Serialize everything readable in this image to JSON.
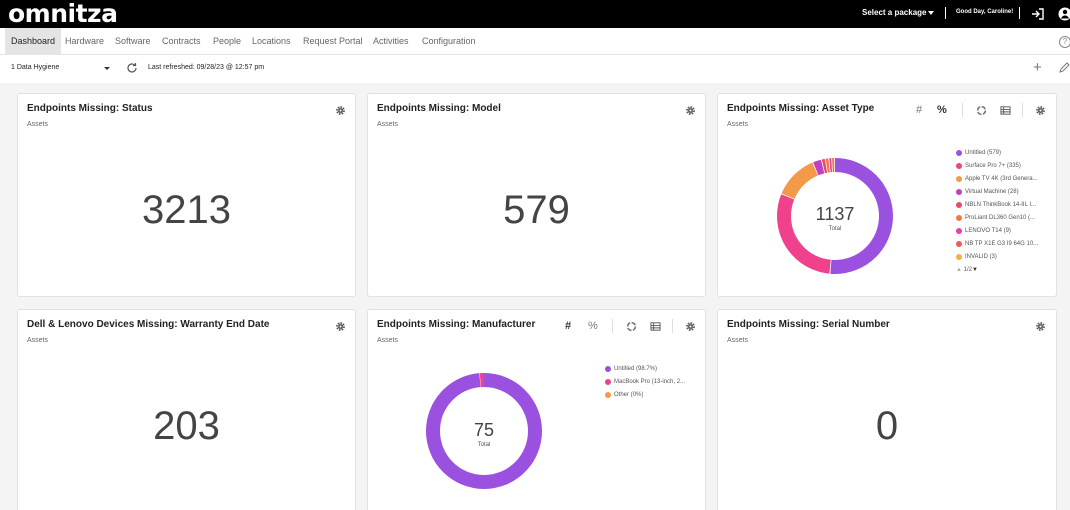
{
  "header": {
    "logo": "omnitza",
    "package_select": "Select a package",
    "greeting": "Good Day, Caroline!"
  },
  "nav": {
    "items": [
      "Dashboard",
      "Hardware",
      "Software",
      "Contracts",
      "People",
      "Locations",
      "Request Portal",
      "Activities",
      "Configuration"
    ],
    "active": "Dashboard"
  },
  "subbar": {
    "dashboard": "1 Data Hygiene",
    "last_refreshed": "Last refreshed: 09/28/23 @ 12:57 pm"
  },
  "cards": [
    {
      "title": "Endpoints Missing: Status",
      "subtitle": "Assets",
      "value": "3213"
    },
    {
      "title": "Endpoints Missing: Model",
      "subtitle": "Assets",
      "value": "579"
    },
    {
      "title": "Endpoints Missing: Asset Type",
      "subtitle": "Assets",
      "tools": [
        "#",
        "%"
      ],
      "donut": {
        "total": "1137",
        "total_label": "Total",
        "legend": [
          {
            "label": "Untitled (579)",
            "color": "#9b51e0"
          },
          {
            "label": "Surface Pro 7+ (335)",
            "color": "#f0418c"
          },
          {
            "label": "Apple TV 4K (3rd Genera...",
            "color": "#f2994a"
          },
          {
            "label": "Virtual Machine (28)",
            "color": "#c13fc4"
          },
          {
            "label": "NBLN ThinkBook 14-IIL I...",
            "color": "#e84a66"
          },
          {
            "label": "ProLiant DL360 Gen10 (...",
            "color": "#f07a3c"
          },
          {
            "label": "LENOVO T14 (9)",
            "color": "#e83fa8"
          },
          {
            "label": "NB TP X1E G3 I9 64G 10...",
            "color": "#f05a5a"
          },
          {
            "label": "INVALID (3)",
            "color": "#f2b04a"
          }
        ],
        "pager": "1/2"
      }
    },
    {
      "title": "Dell & Lenovo Devices Missing: Warranty End Date",
      "subtitle": "Assets",
      "value": "203"
    },
    {
      "title": "Endpoints Missing: Manufacturer",
      "subtitle": "Assets",
      "tools": [
        "#",
        "%"
      ],
      "donut": {
        "total": "75",
        "total_label": "Total",
        "legend": [
          {
            "label": "Untitled (98.7%)",
            "color": "#9b51e0"
          },
          {
            "label": "MacBook Pro (13-inch, 2...",
            "color": "#f0418c"
          },
          {
            "label": "Other (0%)",
            "color": "#f2994a"
          }
        ]
      }
    },
    {
      "title": "Endpoints Missing: Serial Number",
      "subtitle": "Assets",
      "value": "0"
    }
  ],
  "chart_data": [
    {
      "type": "pie",
      "title": "Endpoints Missing: Asset Type",
      "categories": [
        "Untitled",
        "Surface Pro 7+",
        "Apple TV 4K (3rd Genera...",
        "Virtual Machine",
        "NBLN ThinkBook 14-IIL I...",
        "ProLiant DL360 Gen10 (...",
        "LENOVO T14",
        "NB TP X1E G3 I9 64G 10...",
        "INVALID"
      ],
      "values": [
        579,
        335,
        140,
        28,
        12,
        11,
        9,
        8,
        3
      ],
      "colors": [
        "#9b51e0",
        "#f0418c",
        "#f2994a",
        "#c13fc4",
        "#e84a66",
        "#f07a3c",
        "#e83fa8",
        "#f05a5a",
        "#f2b04a"
      ],
      "total": 1137
    },
    {
      "type": "pie",
      "title": "Endpoints Missing: Manufacturer",
      "categories": [
        "Untitled",
        "MacBook Pro (13-inch, 2...",
        "Other"
      ],
      "values": [
        74,
        1,
        0
      ],
      "colors": [
        "#9b51e0",
        "#f0418c",
        "#f2994a"
      ],
      "total": 75
    }
  ]
}
